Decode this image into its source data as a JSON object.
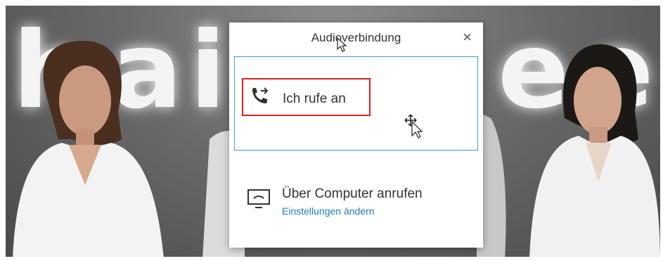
{
  "background": {
    "brand_word": "hairfree"
  },
  "dialog": {
    "title": "Audioverbindung",
    "close_symbol": "×",
    "options": [
      {
        "label": "Ich rufe an",
        "icon": "phone-forward-icon"
      },
      {
        "label": "Über Computer anrufen",
        "link": "Einstellungen ändern",
        "icon": "computer-audio-icon"
      }
    ]
  },
  "colors": {
    "highlight": "#d92020",
    "link": "#1e79c6",
    "selected_border": "#3c9ad8"
  }
}
